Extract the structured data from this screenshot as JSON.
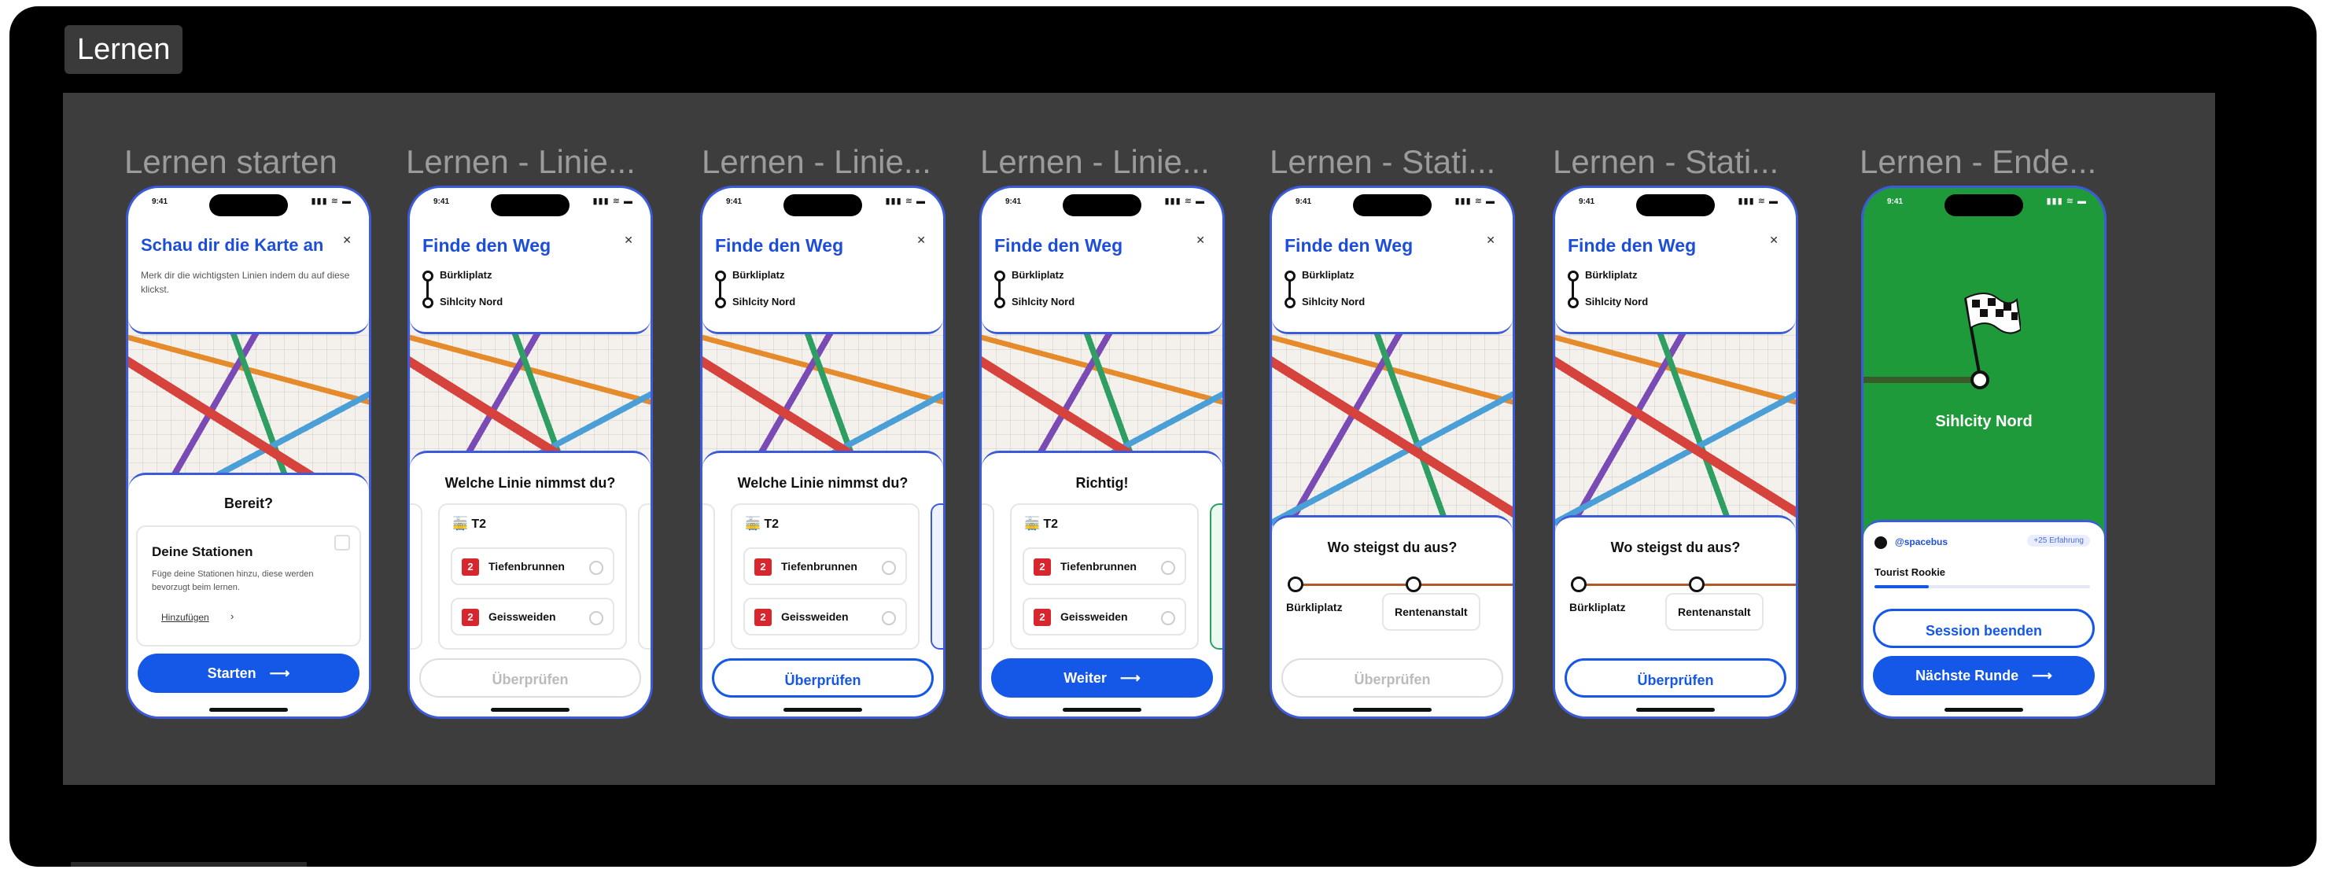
{
  "section_label": "Lernen",
  "frames": [
    {
      "title": "Lernen starten"
    },
    {
      "title": "Lernen - Linie..."
    },
    {
      "title": "Lernen - Linie..."
    },
    {
      "title": "Lernen - Linie..."
    },
    {
      "title": "Lernen - Stati..."
    },
    {
      "title": "Lernen - Stati..."
    },
    {
      "title": "Lernen - Ende..."
    }
  ],
  "status": {
    "time": "9:41",
    "icons": "▮▮▮ ≋ ▬"
  },
  "intro": {
    "heading": "Schau dir die Karte an",
    "description": "Merk dir die wichtigsten Linien indem du auf diese klickst.",
    "ready": "Bereit?",
    "stations_title": "Deine Stationen",
    "stations_desc": "Füge deine Stationen hinzu, diese werden bevorzugt beim lernen.",
    "add_link": "Hinzufügen",
    "start_button": "Starten"
  },
  "route": {
    "heading": "Finde den Weg",
    "from": "Bürkliplatz",
    "to": "Sihlcity Nord"
  },
  "line_question": "Welche Linie nimmst du?",
  "line_correct": "Richtig!",
  "tram_label": "T2",
  "options": [
    {
      "badge": "2",
      "label": "Tiefenbrunnen"
    },
    {
      "badge": "2",
      "label": "Geissweiden"
    }
  ],
  "check_button": "Überprüfen",
  "next_button": "Weiter",
  "station_question": "Wo steigst du aus?",
  "station_from": "Bürkliplatz",
  "station_option": "Rentenanstalt",
  "end": {
    "destination": "Sihlcity Nord",
    "username": "@spacebus",
    "badge": "+25 Erfahrung",
    "rank": "Tourist Rookie",
    "progress": 0.25,
    "end_session": "Session beenden",
    "next_round": "Nächste Runde"
  },
  "colors": {
    "accent": "#1557e6",
    "frame_border": "#3b5bdb",
    "line_badge": "#d7262e",
    "success_green": "#1f9a3b"
  }
}
